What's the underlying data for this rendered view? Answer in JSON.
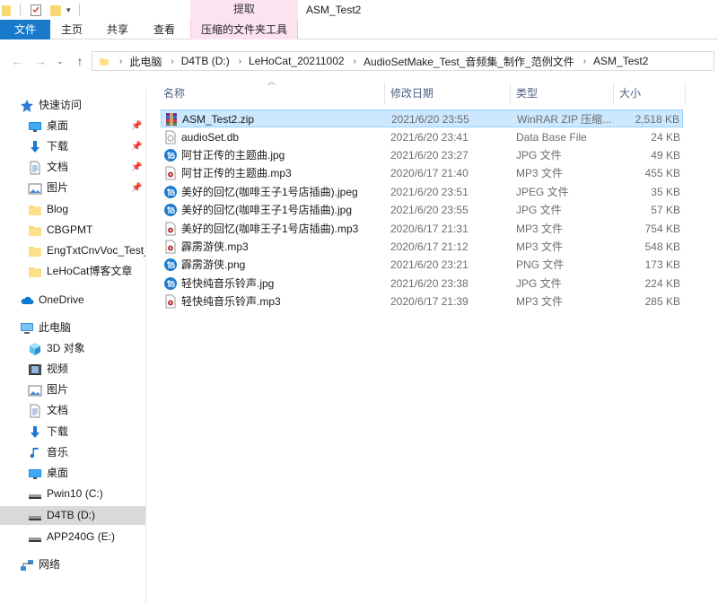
{
  "window": {
    "title": "ASM_Test2"
  },
  "ribbon": {
    "context_header": "提取",
    "tabs": [
      {
        "label": "文件",
        "active": true
      },
      {
        "label": "主页"
      },
      {
        "label": "共享"
      },
      {
        "label": "查看"
      },
      {
        "label": "压缩的文件夹工具"
      }
    ]
  },
  "address": {
    "breadcrumbs": [
      "此电脑",
      "D4TB (D:)",
      "LeHoCat_20211002",
      "AudioSetMake_Test_音频集_制作_范例文件",
      "ASM_Test2"
    ]
  },
  "nav": {
    "quick_access": {
      "label": "快速访问",
      "items": [
        {
          "label": "桌面",
          "icon": "desktop-icon",
          "pinned": true
        },
        {
          "label": "下载",
          "icon": "download-icon",
          "pinned": true
        },
        {
          "label": "文档",
          "icon": "documents-icon",
          "pinned": true
        },
        {
          "label": "图片",
          "icon": "pictures-icon",
          "pinned": true
        },
        {
          "label": "Blog",
          "icon": "folder-icon"
        },
        {
          "label": "CBGPMT",
          "icon": "folder-icon"
        },
        {
          "label": "EngTxtCnvVoc_Test_",
          "icon": "folder-icon"
        },
        {
          "label": "LeHoCat博客文章",
          "icon": "folder-icon"
        }
      ]
    },
    "onedrive": {
      "label": "OneDrive"
    },
    "this_pc": {
      "label": "此电脑",
      "items": [
        {
          "label": "3D 对象",
          "icon": "3d-objects-icon"
        },
        {
          "label": "视频",
          "icon": "videos-icon"
        },
        {
          "label": "图片",
          "icon": "pictures-icon"
        },
        {
          "label": "文档",
          "icon": "documents-icon"
        },
        {
          "label": "下载",
          "icon": "download-icon"
        },
        {
          "label": "音乐",
          "icon": "music-icon"
        },
        {
          "label": "桌面",
          "icon": "desktop-icon"
        },
        {
          "label": "Pwin10 (C:)",
          "icon": "drive-icon"
        },
        {
          "label": "D4TB (D:)",
          "icon": "drive-icon",
          "selected": true
        },
        {
          "label": "APP240G (E:)",
          "icon": "drive-icon"
        }
      ]
    },
    "network": {
      "label": "网络"
    }
  },
  "columns": {
    "name": "名称",
    "date": "修改日期",
    "type": "类型",
    "size": "大小"
  },
  "files": [
    {
      "name": "ASM_Test2.zip",
      "date": "2021/6/20 23:55",
      "type": "WinRAR ZIP 压缩...",
      "size": "2,518 KB",
      "icon": "winrar-icon",
      "selected": true
    },
    {
      "name": "audioSet.db",
      "date": "2021/6/20 23:41",
      "type": "Data Base File",
      "size": "24 KB",
      "icon": "db-file-icon"
    },
    {
      "name": "阿甘正传的主题曲.jpg",
      "date": "2021/6/20 23:27",
      "type": "JPG 文件",
      "size": "49 KB",
      "icon": "image-viewer-icon"
    },
    {
      "name": "阿甘正传的主题曲.mp3",
      "date": "2020/6/17 21:40",
      "type": "MP3 文件",
      "size": "455 KB",
      "icon": "audio-file-icon"
    },
    {
      "name": "美好的回忆(咖啡王子1号店插曲).jpeg",
      "date": "2021/6/20 23:51",
      "type": "JPEG 文件",
      "size": "35 KB",
      "icon": "image-viewer-icon"
    },
    {
      "name": "美好的回忆(咖啡王子1号店插曲).jpg",
      "date": "2021/6/20 23:55",
      "type": "JPG 文件",
      "size": "57 KB",
      "icon": "image-viewer-icon"
    },
    {
      "name": "美好的回忆(咖啡王子1号店插曲).mp3",
      "date": "2020/6/17 21:31",
      "type": "MP3 文件",
      "size": "754 KB",
      "icon": "audio-file-icon"
    },
    {
      "name": "霹雳游侠.mp3",
      "date": "2020/6/17 21:12",
      "type": "MP3 文件",
      "size": "548 KB",
      "icon": "audio-file-icon"
    },
    {
      "name": "霹雳游侠.png",
      "date": "2021/6/20 23:21",
      "type": "PNG 文件",
      "size": "173 KB",
      "icon": "image-viewer-icon"
    },
    {
      "name": "轻快纯音乐铃声.jpg",
      "date": "2021/6/20 23:38",
      "type": "JPG 文件",
      "size": "224 KB",
      "icon": "image-viewer-icon"
    },
    {
      "name": "轻快纯音乐铃声.mp3",
      "date": "2020/6/17 21:39",
      "type": "MP3 文件",
      "size": "285 KB",
      "icon": "audio-file-icon"
    }
  ],
  "colors": {
    "file_tab": "#1979ca",
    "context_tab": "#fbe3f0",
    "selected_row": "#cce8ff",
    "selected_nav": "#d9d9d9",
    "header_text": "#4d6082"
  }
}
